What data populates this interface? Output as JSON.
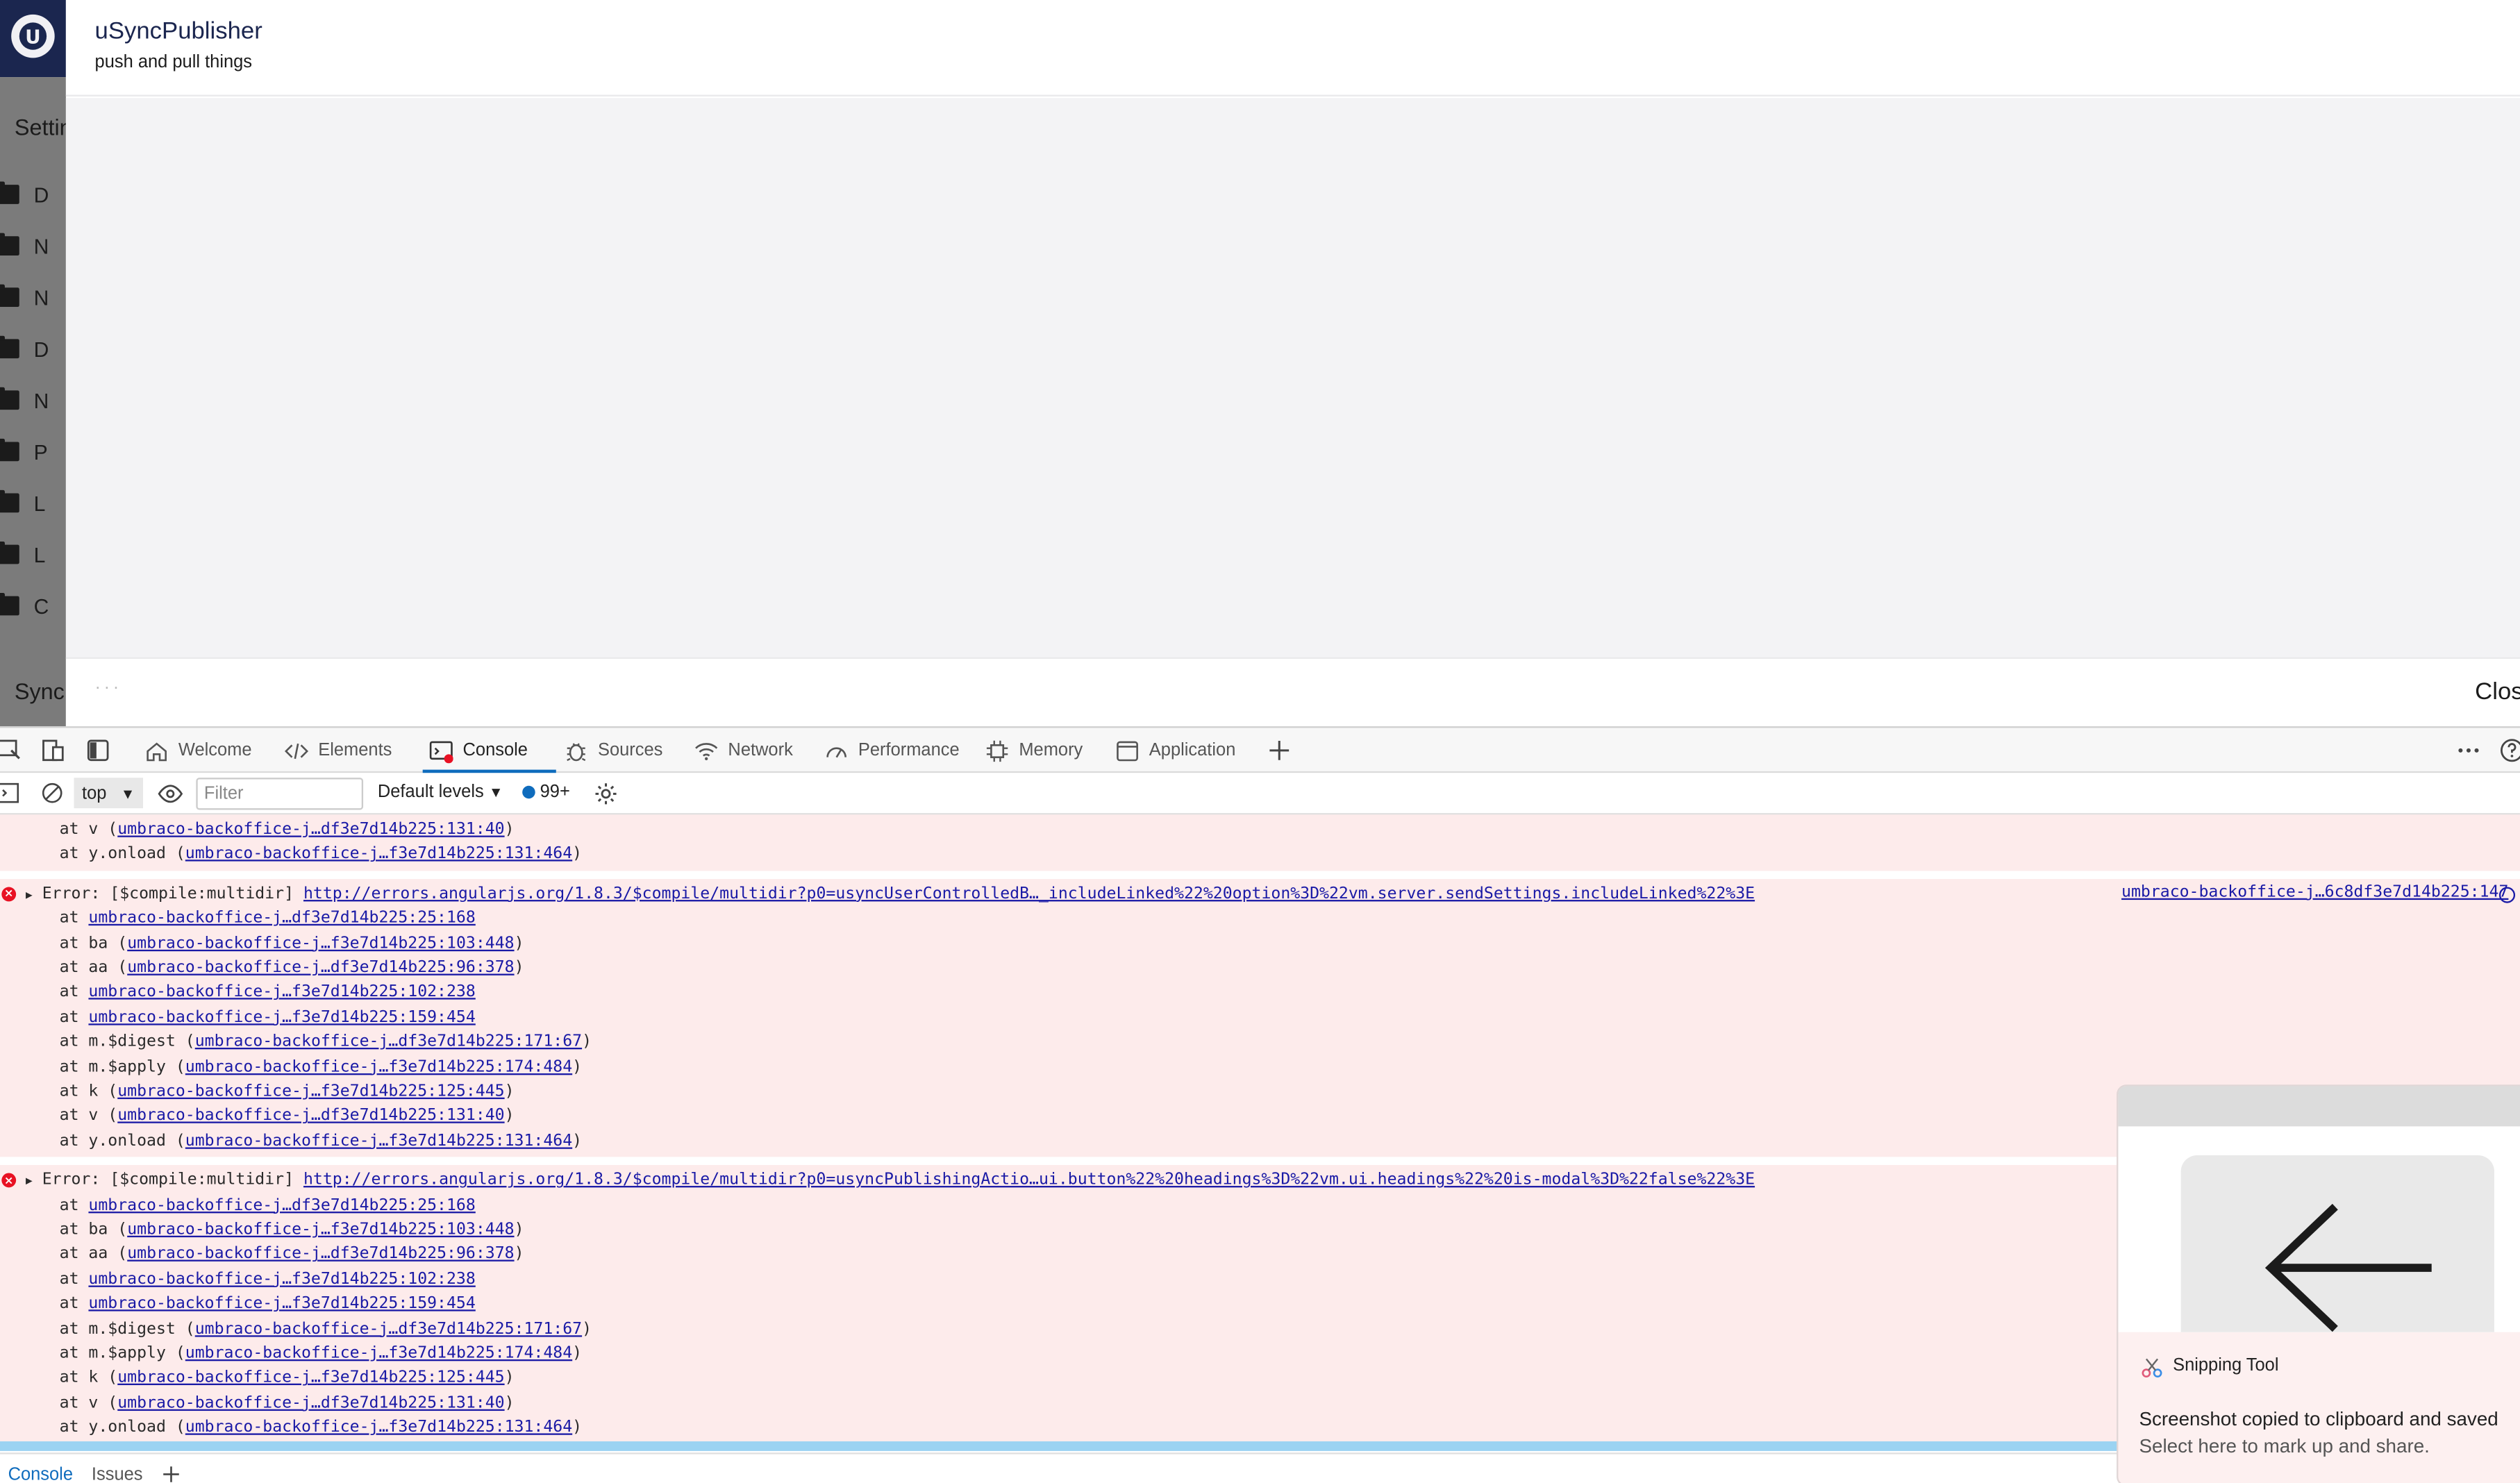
{
  "umbraco": {
    "logo": "U",
    "settings_label": "Settin",
    "tree_items": [
      "D",
      "N",
      "N",
      "D",
      "N",
      "P",
      "L",
      "L",
      "C"
    ],
    "sync_label": "Synch"
  },
  "dialog": {
    "title": "uSyncPublisher",
    "subtitle": "push and pull things",
    "footer_dots": "···",
    "close_label": "Clos"
  },
  "devtools": {
    "tabs": [
      "Welcome",
      "Elements",
      "Console",
      "Sources",
      "Network",
      "Performance",
      "Memory",
      "Application"
    ],
    "active_tab": "Console",
    "context": "top",
    "filter_placeholder": "Filter",
    "levels": "Default levels",
    "message_count": "99+",
    "drawer_tabs": [
      "Console",
      "Issues"
    ]
  },
  "console": {
    "top_lines": [
      {
        "pre": "at v (",
        "link": "umbraco-backoffice-j…df3e7d14b225:131:40",
        "post": ")"
      },
      {
        "pre": "at y.onload (",
        "link": "umbraco-backoffice-j…f3e7d14b225:131:464",
        "post": ")"
      }
    ],
    "errors": [
      {
        "prefix": "Error: [$compile:multidir] ",
        "url": "http://errors.angularjs.org/1.8.3/$compile/multidir?p0=usyncUserControlledB…_includeLinked%22%20option%3D%22vm.server.sendSettings.includeLinked%22%3E",
        "source": "umbraco-backoffice-j…6c8df3e7d14b225:147",
        "stack": [
          {
            "pre": "at ",
            "link": "umbraco-backoffice-j…df3e7d14b225:25:168",
            "post": ""
          },
          {
            "pre": "at ba (",
            "link": "umbraco-backoffice-j…f3e7d14b225:103:448",
            "post": ")"
          },
          {
            "pre": "at aa (",
            "link": "umbraco-backoffice-j…df3e7d14b225:96:378",
            "post": ")"
          },
          {
            "pre": "at ",
            "link": "umbraco-backoffice-j…f3e7d14b225:102:238",
            "post": ""
          },
          {
            "pre": "at ",
            "link": "umbraco-backoffice-j…f3e7d14b225:159:454",
            "post": ""
          },
          {
            "pre": "at m.$digest (",
            "link": "umbraco-backoffice-j…df3e7d14b225:171:67",
            "post": ")"
          },
          {
            "pre": "at m.$apply (",
            "link": "umbraco-backoffice-j…f3e7d14b225:174:484",
            "post": ")"
          },
          {
            "pre": "at k (",
            "link": "umbraco-backoffice-j…f3e7d14b225:125:445",
            "post": ")"
          },
          {
            "pre": "at v (",
            "link": "umbraco-backoffice-j…df3e7d14b225:131:40",
            "post": ")"
          },
          {
            "pre": "at y.onload (",
            "link": "umbraco-backoffice-j…f3e7d14b225:131:464",
            "post": ")"
          }
        ]
      },
      {
        "prefix": "Error: [$compile:multidir] ",
        "url": "http://errors.angularjs.org/1.8.3/$compile/multidir?p0=usyncPublishingActio…ui.button%22%20headings%3D%22vm.ui.headings%22%20is-modal%3D%22false%22%3E",
        "source": "",
        "stack": [
          {
            "pre": "at ",
            "link": "umbraco-backoffice-j…df3e7d14b225:25:168",
            "post": ""
          },
          {
            "pre": "at ba (",
            "link": "umbraco-backoffice-j…f3e7d14b225:103:448",
            "post": ")"
          },
          {
            "pre": "at aa (",
            "link": "umbraco-backoffice-j…df3e7d14b225:96:378",
            "post": ")"
          },
          {
            "pre": "at ",
            "link": "umbraco-backoffice-j…f3e7d14b225:102:238",
            "post": ""
          },
          {
            "pre": "at ",
            "link": "umbraco-backoffice-j…f3e7d14b225:159:454",
            "post": ""
          },
          {
            "pre": "at m.$digest (",
            "link": "umbraco-backoffice-j…df3e7d14b225:171:67",
            "post": ")"
          },
          {
            "pre": "at m.$apply (",
            "link": "umbraco-backoffice-j…f3e7d14b225:174:484",
            "post": ")"
          },
          {
            "pre": "at k (",
            "link": "umbraco-backoffice-j…f3e7d14b225:125:445",
            "post": ")"
          },
          {
            "pre": "at v (",
            "link": "umbraco-backoffice-j…df3e7d14b225:131:40",
            "post": ")"
          },
          {
            "pre": "at y.onload (",
            "link": "umbraco-backoffice-j…f3e7d14b225:131:464",
            "post": ")"
          }
        ]
      }
    ]
  },
  "snipping_tool": {
    "app_name": "Snipping Tool",
    "message": "Screenshot copied to clipboard and saved",
    "sub_message": "Select here to mark up and share."
  }
}
